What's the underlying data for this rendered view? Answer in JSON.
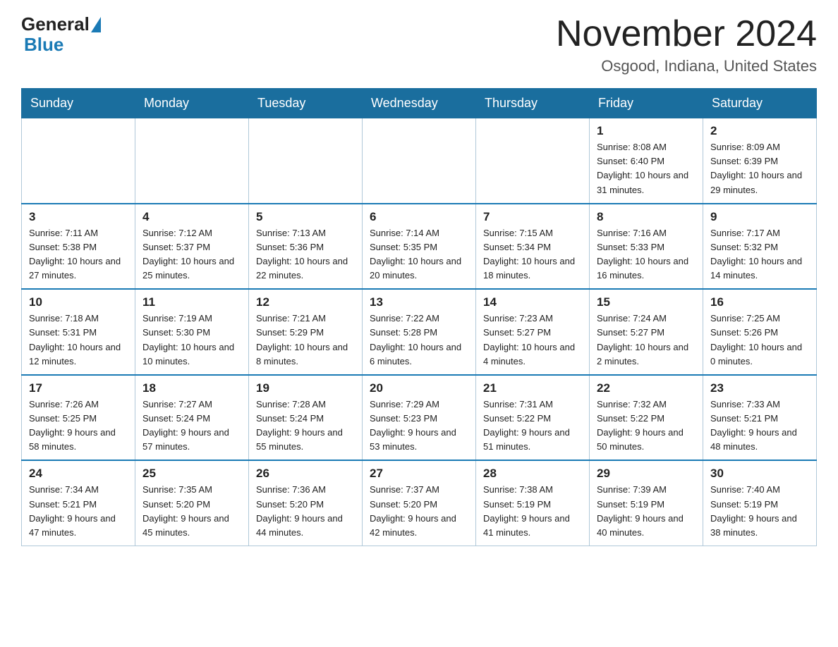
{
  "header": {
    "logo_general": "General",
    "logo_blue": "Blue",
    "month_title": "November 2024",
    "location": "Osgood, Indiana, United States"
  },
  "days_of_week": [
    "Sunday",
    "Monday",
    "Tuesday",
    "Wednesday",
    "Thursday",
    "Friday",
    "Saturday"
  ],
  "weeks": [
    [
      {
        "day": "",
        "info": ""
      },
      {
        "day": "",
        "info": ""
      },
      {
        "day": "",
        "info": ""
      },
      {
        "day": "",
        "info": ""
      },
      {
        "day": "",
        "info": ""
      },
      {
        "day": "1",
        "info": "Sunrise: 8:08 AM\nSunset: 6:40 PM\nDaylight: 10 hours and 31 minutes."
      },
      {
        "day": "2",
        "info": "Sunrise: 8:09 AM\nSunset: 6:39 PM\nDaylight: 10 hours and 29 minutes."
      }
    ],
    [
      {
        "day": "3",
        "info": "Sunrise: 7:11 AM\nSunset: 5:38 PM\nDaylight: 10 hours and 27 minutes."
      },
      {
        "day": "4",
        "info": "Sunrise: 7:12 AM\nSunset: 5:37 PM\nDaylight: 10 hours and 25 minutes."
      },
      {
        "day": "5",
        "info": "Sunrise: 7:13 AM\nSunset: 5:36 PM\nDaylight: 10 hours and 22 minutes."
      },
      {
        "day": "6",
        "info": "Sunrise: 7:14 AM\nSunset: 5:35 PM\nDaylight: 10 hours and 20 minutes."
      },
      {
        "day": "7",
        "info": "Sunrise: 7:15 AM\nSunset: 5:34 PM\nDaylight: 10 hours and 18 minutes."
      },
      {
        "day": "8",
        "info": "Sunrise: 7:16 AM\nSunset: 5:33 PM\nDaylight: 10 hours and 16 minutes."
      },
      {
        "day": "9",
        "info": "Sunrise: 7:17 AM\nSunset: 5:32 PM\nDaylight: 10 hours and 14 minutes."
      }
    ],
    [
      {
        "day": "10",
        "info": "Sunrise: 7:18 AM\nSunset: 5:31 PM\nDaylight: 10 hours and 12 minutes."
      },
      {
        "day": "11",
        "info": "Sunrise: 7:19 AM\nSunset: 5:30 PM\nDaylight: 10 hours and 10 minutes."
      },
      {
        "day": "12",
        "info": "Sunrise: 7:21 AM\nSunset: 5:29 PM\nDaylight: 10 hours and 8 minutes."
      },
      {
        "day": "13",
        "info": "Sunrise: 7:22 AM\nSunset: 5:28 PM\nDaylight: 10 hours and 6 minutes."
      },
      {
        "day": "14",
        "info": "Sunrise: 7:23 AM\nSunset: 5:27 PM\nDaylight: 10 hours and 4 minutes."
      },
      {
        "day": "15",
        "info": "Sunrise: 7:24 AM\nSunset: 5:27 PM\nDaylight: 10 hours and 2 minutes."
      },
      {
        "day": "16",
        "info": "Sunrise: 7:25 AM\nSunset: 5:26 PM\nDaylight: 10 hours and 0 minutes."
      }
    ],
    [
      {
        "day": "17",
        "info": "Sunrise: 7:26 AM\nSunset: 5:25 PM\nDaylight: 9 hours and 58 minutes."
      },
      {
        "day": "18",
        "info": "Sunrise: 7:27 AM\nSunset: 5:24 PM\nDaylight: 9 hours and 57 minutes."
      },
      {
        "day": "19",
        "info": "Sunrise: 7:28 AM\nSunset: 5:24 PM\nDaylight: 9 hours and 55 minutes."
      },
      {
        "day": "20",
        "info": "Sunrise: 7:29 AM\nSunset: 5:23 PM\nDaylight: 9 hours and 53 minutes."
      },
      {
        "day": "21",
        "info": "Sunrise: 7:31 AM\nSunset: 5:22 PM\nDaylight: 9 hours and 51 minutes."
      },
      {
        "day": "22",
        "info": "Sunrise: 7:32 AM\nSunset: 5:22 PM\nDaylight: 9 hours and 50 minutes."
      },
      {
        "day": "23",
        "info": "Sunrise: 7:33 AM\nSunset: 5:21 PM\nDaylight: 9 hours and 48 minutes."
      }
    ],
    [
      {
        "day": "24",
        "info": "Sunrise: 7:34 AM\nSunset: 5:21 PM\nDaylight: 9 hours and 47 minutes."
      },
      {
        "day": "25",
        "info": "Sunrise: 7:35 AM\nSunset: 5:20 PM\nDaylight: 9 hours and 45 minutes."
      },
      {
        "day": "26",
        "info": "Sunrise: 7:36 AM\nSunset: 5:20 PM\nDaylight: 9 hours and 44 minutes."
      },
      {
        "day": "27",
        "info": "Sunrise: 7:37 AM\nSunset: 5:20 PM\nDaylight: 9 hours and 42 minutes."
      },
      {
        "day": "28",
        "info": "Sunrise: 7:38 AM\nSunset: 5:19 PM\nDaylight: 9 hours and 41 minutes."
      },
      {
        "day": "29",
        "info": "Sunrise: 7:39 AM\nSunset: 5:19 PM\nDaylight: 9 hours and 40 minutes."
      },
      {
        "day": "30",
        "info": "Sunrise: 7:40 AM\nSunset: 5:19 PM\nDaylight: 9 hours and 38 minutes."
      }
    ]
  ]
}
